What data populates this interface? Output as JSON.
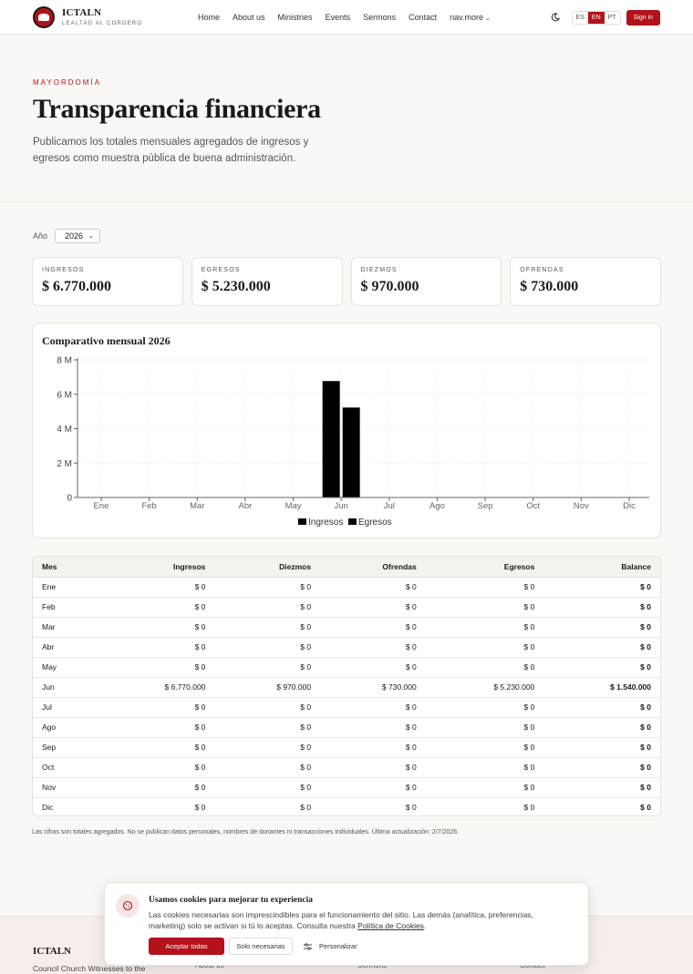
{
  "header": {
    "brand_name": "ICTALN",
    "brand_tagline": "LEALTAD AL CORDERO",
    "nav": [
      "Home",
      "About us",
      "Ministries",
      "Events",
      "Sermons",
      "Contact"
    ],
    "nav_more": "nav.more",
    "langs": [
      "ES",
      "EN",
      "PT"
    ],
    "active_lang": "EN",
    "signin": "Sign in"
  },
  "hero": {
    "eyebrow": "MAYORDOMÍA",
    "title": "Transparencia financiera",
    "description": "Publicamos los totales mensuales agregados de ingresos y egresos como muestra pública de buena administración."
  },
  "filter": {
    "label": "Año",
    "year": "2026"
  },
  "stats": [
    {
      "label": "INGRESOS",
      "value": "$ 6.770.000"
    },
    {
      "label": "EGRESOS",
      "value": "$ 5.230.000"
    },
    {
      "label": "DIEZMOS",
      "value": "$ 970.000"
    },
    {
      "label": "OFRENDAS",
      "value": "$ 730.000"
    }
  ],
  "chart_title": "Comparativo mensual 2026",
  "chart_data": {
    "type": "bar",
    "title": "Comparativo mensual 2026",
    "categories": [
      "Ene",
      "Feb",
      "Mar",
      "Abr",
      "May",
      "Jun",
      "Jul",
      "Ago",
      "Sep",
      "Oct",
      "Nov",
      "Dic"
    ],
    "series": [
      {
        "name": "Ingresos",
        "values": [
          0,
          0,
          0,
          0,
          0,
          6770000,
          0,
          0,
          0,
          0,
          0,
          0
        ],
        "color": "#000000"
      },
      {
        "name": "Egresos",
        "values": [
          0,
          0,
          0,
          0,
          0,
          5230000,
          0,
          0,
          0,
          0,
          0,
          0
        ],
        "color": "#000000"
      }
    ],
    "yticks": [
      {
        "value": 0,
        "label": "0"
      },
      {
        "value": 2000000,
        "label": "2 M"
      },
      {
        "value": 4000000,
        "label": "4 M"
      },
      {
        "value": 6000000,
        "label": "6 M"
      },
      {
        "value": 8000000,
        "label": "8 M"
      }
    ],
    "ylim": [
      0,
      8000000
    ],
    "grid": true,
    "legend": "bottom-center"
  },
  "table": {
    "headers": [
      "Mes",
      "Ingresos",
      "Diezmos",
      "Ofrendas",
      "Egresos",
      "Balance"
    ],
    "rows": [
      [
        "Ene",
        "$ 0",
        "$ 0",
        "$ 0",
        "$ 0",
        "$ 0"
      ],
      [
        "Feb",
        "$ 0",
        "$ 0",
        "$ 0",
        "$ 0",
        "$ 0"
      ],
      [
        "Mar",
        "$ 0",
        "$ 0",
        "$ 0",
        "$ 0",
        "$ 0"
      ],
      [
        "Abr",
        "$ 0",
        "$ 0",
        "$ 0",
        "$ 0",
        "$ 0"
      ],
      [
        "May",
        "$ 0",
        "$ 0",
        "$ 0",
        "$ 0",
        "$ 0"
      ],
      [
        "Jun",
        "$ 6.770.000",
        "$ 970.000",
        "$ 730.000",
        "$ 5.230.000",
        "$ 1.540.000"
      ],
      [
        "Jul",
        "$ 0",
        "$ 0",
        "$ 0",
        "$ 0",
        "$ 0"
      ],
      [
        "Ago",
        "$ 0",
        "$ 0",
        "$ 0",
        "$ 0",
        "$ 0"
      ],
      [
        "Sep",
        "$ 0",
        "$ 0",
        "$ 0",
        "$ 0",
        "$ 0"
      ],
      [
        "Oct",
        "$ 0",
        "$ 0",
        "$ 0",
        "$ 0",
        "$ 0"
      ],
      [
        "Nov",
        "$ 0",
        "$ 0",
        "$ 0",
        "$ 0",
        "$ 0"
      ],
      [
        "Dic",
        "$ 0",
        "$ 0",
        "$ 0",
        "$ 0",
        "$ 0"
      ]
    ]
  },
  "footnote": "Las cifras son totales agregados. No se publican datos personales, nombres de donantes ni transacciones individuales. Última actualización: 2/7/2026.",
  "footer": {
    "name": "ICTALN",
    "description": "Council Church Witnesses to the",
    "links": [
      "About us",
      "Sermons",
      "Contact"
    ]
  },
  "cookie": {
    "title": "Usamos cookies para mejorar tu experiencia",
    "text": "Las cookies necesarias son imprescindibles para el funcionamiento del sitio. Las demás (analítica, preferencias, marketing) solo se activan si tú lo aceptas. Consulta nuestra",
    "link": "Política de Cookies",
    "text_end": ".",
    "accept": "Aceptar todas",
    "necessary": "Solo necesarias",
    "customize": "Personalizar"
  },
  "colors": {
    "accent": "#b3121b",
    "background": "#faf8f5",
    "bars": "#000000"
  }
}
